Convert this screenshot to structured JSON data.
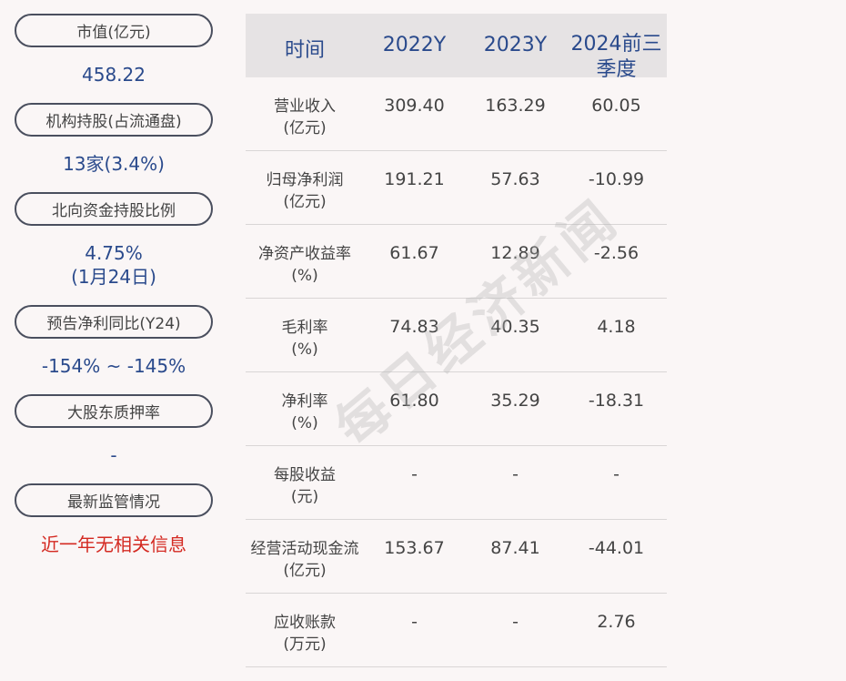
{
  "sidebar": {
    "items": [
      {
        "label": "市值(亿元)",
        "value": "458.22"
      },
      {
        "label": "机构持股(占流通盘)",
        "value": "13家(3.4%)"
      },
      {
        "label": "北向资金持股比例",
        "value": "4.75%",
        "value2": "(1月24日)"
      },
      {
        "label": "预告净利同比(Y24)",
        "value": "-154% ~ -145%"
      },
      {
        "label": "大股东质押率",
        "value": "-"
      },
      {
        "label": "最新监管情况",
        "value": "近一年无相关信息"
      }
    ]
  },
  "table": {
    "headers": [
      "时间",
      "2022Y",
      "2023Y",
      "2024前三",
      "季度"
    ],
    "rows": [
      {
        "l1": "营业收入",
        "l2": "(亿元)",
        "v": [
          "309.40",
          "163.29",
          "60.05"
        ]
      },
      {
        "l1": "归母净利润",
        "l2": "(亿元)",
        "v": [
          "191.21",
          "57.63",
          "-10.99"
        ]
      },
      {
        "l1": "净资产收益率",
        "l2": "(%)",
        "v": [
          "61.67",
          "12.89",
          "-2.56"
        ]
      },
      {
        "l1": "毛利率",
        "l2": "(%)",
        "v": [
          "74.83",
          "40.35",
          "4.18"
        ]
      },
      {
        "l1": "净利率",
        "l2": "(%)",
        "v": [
          "61.80",
          "35.29",
          "-18.31"
        ]
      },
      {
        "l1": "每股收益",
        "l2": "(元)",
        "v": [
          "-",
          "-",
          "-"
        ]
      },
      {
        "l1": "经营活动现金流",
        "l2": "(亿元)",
        "v": [
          "153.67",
          "87.41",
          "-44.01"
        ]
      },
      {
        "l1": "应收账款",
        "l2": "(万元)",
        "v": [
          "-",
          "-",
          "2.76"
        ]
      }
    ]
  },
  "watermark": "每日经济新闻",
  "colors": {
    "accent": "#2a4a8c",
    "alert": "#d42a22",
    "header_bg": "#e6e3e4"
  }
}
